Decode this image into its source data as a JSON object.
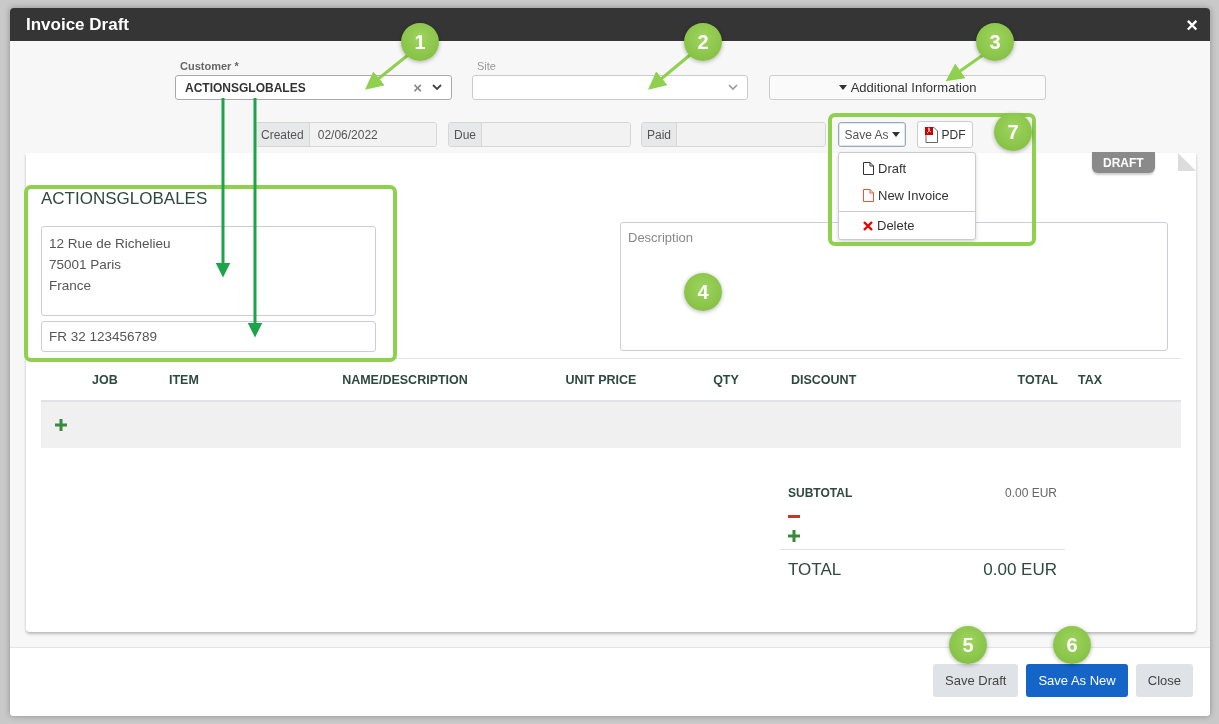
{
  "window": {
    "title": "Invoice Draft",
    "close": "×"
  },
  "customer": {
    "label": "Customer *",
    "value": "ACTIONSGLOBALES",
    "clear": "×"
  },
  "site": {
    "label": "Site"
  },
  "additional_info": {
    "label": "Additional Information"
  },
  "dates": [
    {
      "label": "Created",
      "value": "02/06/2022"
    },
    {
      "label": "Due"
    },
    {
      "label": "Paid"
    }
  ],
  "save_as": {
    "label": "Save As",
    "expanded": true,
    "menu": [
      {
        "label": "Draft",
        "kind": "document"
      },
      {
        "label": "New Invoice",
        "kind": "new-document"
      },
      {
        "label": "Delete",
        "kind": "delete"
      }
    ]
  },
  "pdf": {
    "label": "PDF"
  },
  "status_badge": "DRAFT",
  "bill_to": {
    "name": "ACTIONSGLOBALES",
    "address": [
      "12 Rue de Richelieu",
      "75001 Paris",
      "France"
    ],
    "vat": "FR 32 123456789"
  },
  "description": {
    "placeholder": "Description"
  },
  "table": {
    "columns": [
      "JOB",
      "ITEM",
      "NAME/DESCRIPTION",
      "UNIT PRICE",
      "QTY",
      "DISCOUNT",
      "TOTAL",
      "TAX"
    ]
  },
  "totals": {
    "subtotal_label": "SUBTOTAL",
    "subtotal": "0.00 EUR",
    "total_label": "TOTAL",
    "total": "0.00 EUR"
  },
  "buttons": [
    {
      "label": "Save Draft",
      "kind": "secondary"
    },
    {
      "label": "Save As New",
      "kind": "primary"
    },
    {
      "label": "Close",
      "kind": "secondary"
    }
  ],
  "callouts": [
    "1",
    "2",
    "3",
    "4",
    "5",
    "6",
    "7"
  ]
}
